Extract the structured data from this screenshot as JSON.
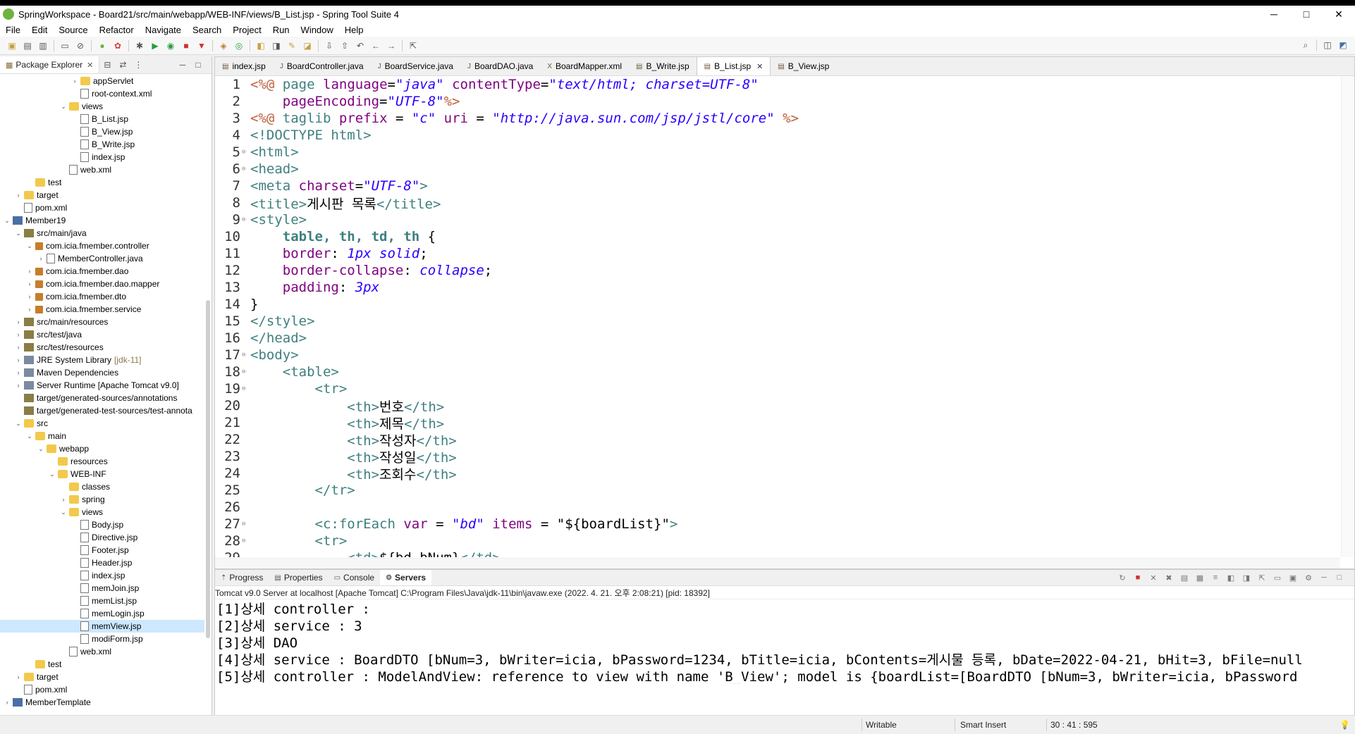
{
  "window": {
    "title": "SpringWorkspace - Board21/src/main/webapp/WEB-INF/views/B_List.jsp - Spring Tool Suite 4",
    "minimize": "─",
    "maximize": "□",
    "close": "✕"
  },
  "menu": [
    "File",
    "Edit",
    "Source",
    "Refactor",
    "Navigate",
    "Search",
    "Project",
    "Run",
    "Window",
    "Help"
  ],
  "explorer": {
    "tab_label": "Package Explorer",
    "items": [
      {
        "label": "appServlet",
        "depth": 6,
        "type": "folder",
        "arrow": "›"
      },
      {
        "label": "root-context.xml",
        "depth": 6,
        "type": "file",
        "arrow": ""
      },
      {
        "label": "views",
        "depth": 5,
        "type": "folder",
        "arrow": "⌄"
      },
      {
        "label": "B_List.jsp",
        "depth": 6,
        "type": "file",
        "arrow": ""
      },
      {
        "label": "B_View.jsp",
        "depth": 6,
        "type": "file",
        "arrow": ""
      },
      {
        "label": "B_Write.jsp",
        "depth": 6,
        "type": "file",
        "arrow": ""
      },
      {
        "label": "index.jsp",
        "depth": 6,
        "type": "file",
        "arrow": ""
      },
      {
        "label": "web.xml",
        "depth": 5,
        "type": "file",
        "arrow": ""
      },
      {
        "label": "test",
        "depth": 2,
        "type": "folder",
        "arrow": ""
      },
      {
        "label": "target",
        "depth": 1,
        "type": "folder",
        "arrow": "›"
      },
      {
        "label": "pom.xml",
        "depth": 1,
        "type": "file",
        "arrow": ""
      },
      {
        "label": "Member19",
        "depth": 0,
        "type": "proj",
        "arrow": "⌄"
      },
      {
        "label": "src/main/java",
        "depth": 1,
        "type": "src",
        "arrow": "⌄"
      },
      {
        "label": "com.icia.fmember.controller",
        "depth": 2,
        "type": "pkg",
        "arrow": "⌄"
      },
      {
        "label": "MemberController.java",
        "depth": 3,
        "type": "file",
        "arrow": "›"
      },
      {
        "label": "com.icia.fmember.dao",
        "depth": 2,
        "type": "pkg",
        "arrow": "›"
      },
      {
        "label": "com.icia.fmember.dao.mapper",
        "depth": 2,
        "type": "pkg",
        "arrow": "›"
      },
      {
        "label": "com.icia.fmember.dto",
        "depth": 2,
        "type": "pkg",
        "arrow": "›"
      },
      {
        "label": "com.icia.fmember.service",
        "depth": 2,
        "type": "pkg",
        "arrow": "›"
      },
      {
        "label": "src/main/resources",
        "depth": 1,
        "type": "src",
        "arrow": "›"
      },
      {
        "label": "src/test/java",
        "depth": 1,
        "type": "src",
        "arrow": "›"
      },
      {
        "label": "src/test/resources",
        "depth": 1,
        "type": "src",
        "arrow": "›"
      },
      {
        "label": "JRE System Library",
        "suffix": "[jdk-11]",
        "depth": 1,
        "type": "lib",
        "arrow": "›"
      },
      {
        "label": "Maven Dependencies",
        "depth": 1,
        "type": "lib",
        "arrow": "›"
      },
      {
        "label": "Server Runtime [Apache Tomcat v9.0]",
        "depth": 1,
        "type": "lib",
        "arrow": "›"
      },
      {
        "label": "target/generated-sources/annotations",
        "depth": 1,
        "type": "src",
        "arrow": ""
      },
      {
        "label": "target/generated-test-sources/test-annota",
        "depth": 1,
        "type": "src",
        "arrow": ""
      },
      {
        "label": "src",
        "depth": 1,
        "type": "folder",
        "arrow": "⌄"
      },
      {
        "label": "main",
        "depth": 2,
        "type": "folder",
        "arrow": "⌄"
      },
      {
        "label": "webapp",
        "depth": 3,
        "type": "folder",
        "arrow": "⌄"
      },
      {
        "label": "resources",
        "depth": 4,
        "type": "folder",
        "arrow": ""
      },
      {
        "label": "WEB-INF",
        "depth": 4,
        "type": "folder",
        "arrow": "⌄"
      },
      {
        "label": "classes",
        "depth": 5,
        "type": "folder",
        "arrow": ""
      },
      {
        "label": "spring",
        "depth": 5,
        "type": "folder",
        "arrow": "›"
      },
      {
        "label": "views",
        "depth": 5,
        "type": "folder",
        "arrow": "⌄"
      },
      {
        "label": "Body.jsp",
        "depth": 6,
        "type": "file",
        "arrow": ""
      },
      {
        "label": "Directive.jsp",
        "depth": 6,
        "type": "file",
        "arrow": ""
      },
      {
        "label": "Footer.jsp",
        "depth": 6,
        "type": "file",
        "arrow": ""
      },
      {
        "label": "Header.jsp",
        "depth": 6,
        "type": "file",
        "arrow": ""
      },
      {
        "label": "index.jsp",
        "depth": 6,
        "type": "file",
        "arrow": ""
      },
      {
        "label": "memJoin.jsp",
        "depth": 6,
        "type": "file",
        "arrow": ""
      },
      {
        "label": "memList.jsp",
        "depth": 6,
        "type": "file",
        "arrow": ""
      },
      {
        "label": "memLogin.jsp",
        "depth": 6,
        "type": "file",
        "arrow": ""
      },
      {
        "label": "memView.jsp",
        "depth": 6,
        "type": "file",
        "arrow": "",
        "selected": true
      },
      {
        "label": "modiForm.jsp",
        "depth": 6,
        "type": "file",
        "arrow": ""
      },
      {
        "label": "web.xml",
        "depth": 5,
        "type": "file",
        "arrow": ""
      },
      {
        "label": "test",
        "depth": 2,
        "type": "folder",
        "arrow": ""
      },
      {
        "label": "target",
        "depth": 1,
        "type": "folder",
        "arrow": "›"
      },
      {
        "label": "pom.xml",
        "depth": 1,
        "type": "file",
        "arrow": ""
      },
      {
        "label": "MemberTemplate",
        "depth": 0,
        "type": "proj",
        "arrow": "›"
      }
    ]
  },
  "editor": {
    "tabs": [
      {
        "label": "index.jsp",
        "active": false
      },
      {
        "label": "BoardController.java",
        "active": false
      },
      {
        "label": "BoardService.java",
        "active": false
      },
      {
        "label": "BoardDAO.java",
        "active": false
      },
      {
        "label": "BoardMapper.xml",
        "active": false
      },
      {
        "label": "B_Write.jsp",
        "active": false
      },
      {
        "label": "B_List.jsp",
        "active": true
      },
      {
        "label": "B_View.jsp",
        "active": false
      }
    ],
    "lines": [
      {
        "n": "1",
        "fold": "",
        "html": "<span class=\"dir\">&lt;%@</span> <span class=\"tag\">page</span> <span class=\"attr\">language</span>=<span class=\"str\">\"java\"</span> <span class=\"attr\">contentType</span>=<span class=\"str\">\"text/html; charset=UTF-8\"</span>"
      },
      {
        "n": "2",
        "fold": "",
        "html": "    <span class=\"attr\">pageEncoding</span>=<span class=\"str\">\"UTF-8\"</span><span class=\"dir\">%&gt;</span>"
      },
      {
        "n": "3",
        "fold": "",
        "html": "<span class=\"dir\">&lt;%@</span> <span class=\"tag\">taglib</span> <span class=\"attr\">prefix</span> = <span class=\"str\">\"c\"</span> <span class=\"attr\">uri</span> = <span class=\"str\">\"http://java.sun.com/jsp/jstl/core\"</span> <span class=\"dir\">%&gt;</span>"
      },
      {
        "n": "4",
        "fold": "",
        "html": "<span class=\"tag\">&lt;!DOCTYPE html&gt;</span>"
      },
      {
        "n": "5",
        "fold": "⊖",
        "html": "<span class=\"tag\">&lt;html&gt;</span>"
      },
      {
        "n": "6",
        "fold": "⊖",
        "html": "<span class=\"tag\">&lt;head&gt;</span>"
      },
      {
        "n": "7",
        "fold": "",
        "html": "<span class=\"tag\">&lt;meta</span> <span class=\"attr\">charset</span>=<span class=\"str\">\"UTF-8\"</span><span class=\"tag\">&gt;</span>"
      },
      {
        "n": "8",
        "fold": "",
        "html": "<span class=\"tag\">&lt;title&gt;</span>게시판 목록<span class=\"tag\">&lt;/title&gt;</span>"
      },
      {
        "n": "9",
        "fold": "⊖",
        "html": "<span class=\"tag\">&lt;style&gt;</span>"
      },
      {
        "n": "10",
        "fold": "",
        "html": "    <span class=\"css-sel\">table, th, td, th</span> {"
      },
      {
        "n": "11",
        "fold": "",
        "html": "    <span class=\"css-prop\">border</span>: <span class=\"css-val\">1px solid</span>;"
      },
      {
        "n": "12",
        "fold": "",
        "html": "    <span class=\"css-prop\">border-collapse</span>: <span class=\"css-val\">collapse</span>;"
      },
      {
        "n": "13",
        "fold": "",
        "html": "    <span class=\"css-prop\">padding</span>: <span class=\"css-val\">3px</span>"
      },
      {
        "n": "14",
        "fold": "",
        "html": "}"
      },
      {
        "n": "15",
        "fold": "",
        "html": "<span class=\"tag\">&lt;/style&gt;</span>"
      },
      {
        "n": "16",
        "fold": "",
        "html": "<span class=\"tag\">&lt;/head&gt;</span>"
      },
      {
        "n": "17",
        "fold": "⊖",
        "html": "<span class=\"tag\">&lt;body&gt;</span>"
      },
      {
        "n": "18",
        "fold": "⊖",
        "html": "    <span class=\"tag\">&lt;table&gt;</span>"
      },
      {
        "n": "19",
        "fold": "⊖",
        "html": "        <span class=\"tag\">&lt;tr&gt;</span>"
      },
      {
        "n": "20",
        "fold": "",
        "html": "            <span class=\"tag\">&lt;th&gt;</span>번호<span class=\"tag\">&lt;/th&gt;</span>"
      },
      {
        "n": "21",
        "fold": "",
        "html": "            <span class=\"tag\">&lt;th&gt;</span>제목<span class=\"tag\">&lt;/th&gt;</span>"
      },
      {
        "n": "22",
        "fold": "",
        "html": "            <span class=\"tag\">&lt;th&gt;</span>작성자<span class=\"tag\">&lt;/th&gt;</span>"
      },
      {
        "n": "23",
        "fold": "",
        "html": "            <span class=\"tag\">&lt;th&gt;</span>작성일<span class=\"tag\">&lt;/th&gt;</span>"
      },
      {
        "n": "24",
        "fold": "",
        "html": "            <span class=\"tag\">&lt;th&gt;</span>조회수<span class=\"tag\">&lt;/th&gt;</span>"
      },
      {
        "n": "25",
        "fold": "",
        "html": "        <span class=\"tag\">&lt;/tr&gt;</span>"
      },
      {
        "n": "26",
        "fold": "",
        "html": ""
      },
      {
        "n": "27",
        "fold": "⊖",
        "html": "        <span class=\"tag\">&lt;c:forEach</span> <span class=\"attr\">var</span> = <span class=\"str\">\"bd\"</span> <span class=\"attr\">items</span> = \"${boardList}\"<span class=\"tag\">&gt;</span>"
      },
      {
        "n": "28",
        "fold": "⊖",
        "html": "        <span class=\"tag\">&lt;tr&gt;</span>"
      },
      {
        "n": "29",
        "fold": "",
        "html": "            <span class=\"tag\">&lt;td&gt;</span>${bd.bNum}<span class=\"tag\">&lt;/td&gt;</span>"
      }
    ]
  },
  "console": {
    "tabs": [
      {
        "label": "Progress",
        "active": false
      },
      {
        "label": "Properties",
        "active": false
      },
      {
        "label": "Console",
        "active": false
      },
      {
        "label": "Servers",
        "active": true
      }
    ],
    "description": "Tomcat v9.0 Server at localhost [Apache Tomcat] C:\\Program Files\\Java\\jdk-11\\bin\\javaw.exe  (2022. 4. 21. 오후 2:08:21) [pid: 18392]",
    "lines": [
      "[1]상세 controller :",
      "[2]상세 service : 3",
      "[3]상세 DAO",
      "[4]상세 service : BoardDTO [bNum=3, bWriter=icia, bPassword=1234, bTitle=icia, bContents=게시물 등록, bDate=2022-04-21, bHit=3, bFile=null",
      "[5]상세 controller : ModelAndView: reference to view with name 'B_View'; model is {boardList=[BoardDTO [bNum=3, bWriter=icia, bPassword"
    ]
  },
  "status": {
    "writable": "Writable",
    "insert_mode": "Smart Insert",
    "position": "30 : 41 : 595"
  }
}
